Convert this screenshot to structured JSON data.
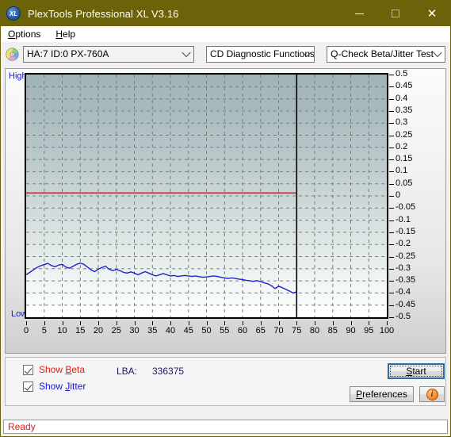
{
  "window": {
    "title": "PlexTools Professional XL V3.16",
    "icon": "xl-app-icon",
    "minimize": "—",
    "maximize": "□",
    "close": "✕"
  },
  "menu": {
    "items": [
      {
        "label": "Options",
        "accel": "O"
      },
      {
        "label": "Help",
        "accel": "H"
      }
    ]
  },
  "toolbar": {
    "disc_icon": "cd-disc-icon",
    "device": "HA:7 ID:0  PX-760A",
    "function": "CD Diagnostic Functions",
    "test": "Q-Check Beta/Jitter Test"
  },
  "chart_panel": {
    "high_label": "High",
    "low_label": "Low"
  },
  "controls": {
    "show_beta": {
      "label": "Show Beta",
      "accel": "B",
      "checked": true,
      "color": "#e01b1b"
    },
    "show_jitter": {
      "label": "Show Jitter",
      "accel": "J",
      "checked": true,
      "color": "#1616d8"
    },
    "lba_label": "LBA:",
    "lba_value": "336375",
    "start_label": "Start",
    "start_accel": "S",
    "preferences_label": "Preferences",
    "preferences_accel": "P",
    "info_icon": "info-icon",
    "info_glyph": "i"
  },
  "status": {
    "text": "Ready"
  },
  "chart_data": {
    "type": "line",
    "title": "Q-Check Beta/Jitter Test",
    "xlabel": "",
    "ylabel": "",
    "xlim": [
      0,
      100
    ],
    "ylim": [
      -0.5,
      0.5
    ],
    "grid": true,
    "legend": "none",
    "x_ticks": [
      0,
      5,
      10,
      15,
      20,
      25,
      30,
      35,
      40,
      45,
      50,
      55,
      60,
      65,
      70,
      75,
      80,
      85,
      90,
      95,
      100
    ],
    "y_ticks": [
      0.5,
      0.45,
      0.4,
      0.35,
      0.3,
      0.25,
      0.2,
      0.15,
      0.1,
      0.05,
      0,
      -0.05,
      -0.1,
      -0.15,
      -0.2,
      -0.25,
      -0.3,
      -0.35,
      -0.4,
      -0.45,
      -0.5
    ],
    "data_end_marker_x": 75,
    "annotations": [
      {
        "text": "High",
        "position": "axis-top-left",
        "color": "#1616d8"
      },
      {
        "text": "Low",
        "position": "axis-bottom-left",
        "color": "#1616d8"
      }
    ],
    "series": [
      {
        "name": "Beta",
        "color": "#e01b1b",
        "x": [
          0,
          3,
          6,
          9,
          12,
          15,
          18,
          21,
          24,
          27,
          30,
          33,
          36,
          39,
          42,
          45,
          48,
          51,
          54,
          57,
          60,
          63,
          66,
          69,
          72,
          75
        ],
        "values": [
          0.012,
          0.012,
          0.012,
          0.012,
          0.012,
          0.012,
          0.012,
          0.012,
          0.012,
          0.012,
          0.012,
          0.012,
          0.012,
          0.012,
          0.012,
          0.012,
          0.012,
          0.012,
          0.012,
          0.012,
          0.012,
          0.012,
          0.012,
          0.012,
          0.012,
          0.012
        ]
      },
      {
        "name": "Jitter",
        "color": "#1f22c8",
        "x": [
          0,
          1,
          2,
          3,
          4,
          5,
          6,
          7,
          8,
          9,
          10,
          11,
          12,
          13,
          14,
          15,
          16,
          17,
          18,
          19,
          20,
          21,
          22,
          23,
          24,
          25,
          26,
          27,
          28,
          29,
          30,
          31,
          32,
          33,
          34,
          35,
          36,
          37,
          38,
          39,
          40,
          41,
          42,
          43,
          44,
          45,
          46,
          47,
          48,
          49,
          50,
          51,
          52,
          53,
          54,
          55,
          56,
          57,
          58,
          59,
          60,
          61,
          62,
          63,
          64,
          65,
          66,
          67,
          68,
          69,
          70,
          71,
          72,
          73,
          74,
          75
        ],
        "values": [
          -0.325,
          -0.315,
          -0.305,
          -0.295,
          -0.288,
          -0.283,
          -0.278,
          -0.287,
          -0.292,
          -0.285,
          -0.282,
          -0.293,
          -0.298,
          -0.29,
          -0.282,
          -0.277,
          -0.282,
          -0.293,
          -0.305,
          -0.312,
          -0.302,
          -0.295,
          -0.29,
          -0.302,
          -0.308,
          -0.303,
          -0.308,
          -0.315,
          -0.318,
          -0.313,
          -0.318,
          -0.325,
          -0.318,
          -0.312,
          -0.318,
          -0.325,
          -0.33,
          -0.325,
          -0.32,
          -0.325,
          -0.33,
          -0.328,
          -0.332,
          -0.33,
          -0.328,
          -0.33,
          -0.332,
          -0.33,
          -0.333,
          -0.335,
          -0.334,
          -0.332,
          -0.33,
          -0.332,
          -0.335,
          -0.338,
          -0.34,
          -0.338,
          -0.34,
          -0.343,
          -0.345,
          -0.348,
          -0.35,
          -0.352,
          -0.349,
          -0.353,
          -0.358,
          -0.362,
          -0.37,
          -0.382,
          -0.372,
          -0.378,
          -0.385,
          -0.392,
          -0.4,
          -0.395
        ]
      }
    ]
  }
}
